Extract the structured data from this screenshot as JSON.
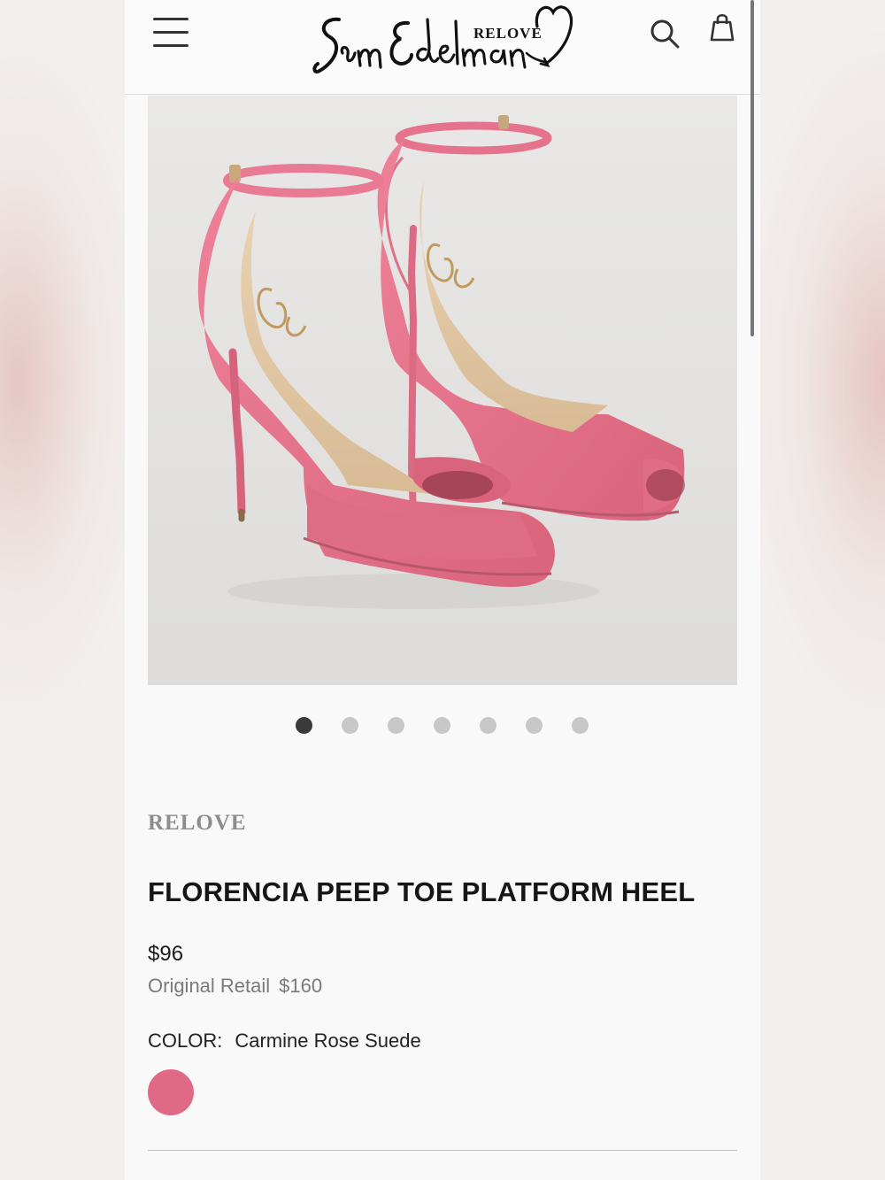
{
  "header": {
    "brand_script": "Sam Edelman",
    "brand_relove": "RELOVE"
  },
  "gallery": {
    "total_images": 7,
    "active_index": 0
  },
  "product": {
    "relove_logo": "RELOVE",
    "name": "FLORENCIA PEEP TOE PLATFORM HEEL",
    "price": "$96",
    "original_retail_label": "Original Retail",
    "original_retail_value": "$160",
    "color_label": "COLOR:",
    "color_value": "Carmine Rose Suede",
    "swatch_color": "#e06a85"
  },
  "colors": {
    "shoe_primary": "#e8768c",
    "shoe_shadow": "#cf5c74",
    "insole": "#e2c9a6"
  }
}
